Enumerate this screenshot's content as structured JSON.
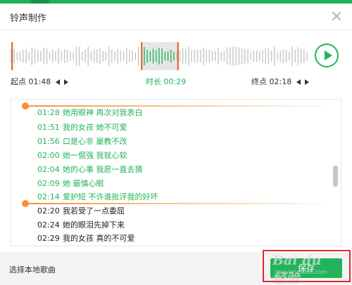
{
  "window": {
    "title": "铃声制作"
  },
  "timeline": {
    "start_label": "起点",
    "start_time": "01:48",
    "duration_label": "时长",
    "duration_time": "00:29",
    "end_label": "终点",
    "end_time": "02:18",
    "selection_fraction": [
      0.44,
      0.56
    ]
  },
  "lyrics": [
    {
      "time": "01:28",
      "text": "她用眼神 再次对我表白",
      "state": "selected"
    },
    {
      "time": "01:51",
      "text": "我的女孩 她不可爱",
      "state": "selected"
    },
    {
      "time": "01:56",
      "text": "口是心非 屡教不改",
      "state": "selected"
    },
    {
      "time": "02:00",
      "text": "她一倔强 我就心软",
      "state": "selected"
    },
    {
      "time": "02:04",
      "text": "她的心事 我愿一直去猜",
      "state": "selected"
    },
    {
      "time": "02:09",
      "text": "她 最慎心眼",
      "state": "selected"
    },
    {
      "time": "02:14",
      "text": "爱护短 不许谁批评我的好坏",
      "state": "selected"
    },
    {
      "time": "02:20",
      "text": "我若受了一点委屈",
      "state": "normal"
    },
    {
      "time": "02:24",
      "text": "她的眼泪先掉下来",
      "state": "normal"
    },
    {
      "time": "02:29",
      "text": "我的女孩 真的不可爱",
      "state": "normal"
    }
  ],
  "footer": {
    "local_song": "选择本地歌曲",
    "save_label": "保存"
  },
  "watermark": {
    "brand": "Bai du 经验",
    "url": "jingyan.baidu.com"
  },
  "colors": {
    "accent": "#22b45b",
    "marker": "#f5913b",
    "highlight_box": "#e0262a"
  }
}
